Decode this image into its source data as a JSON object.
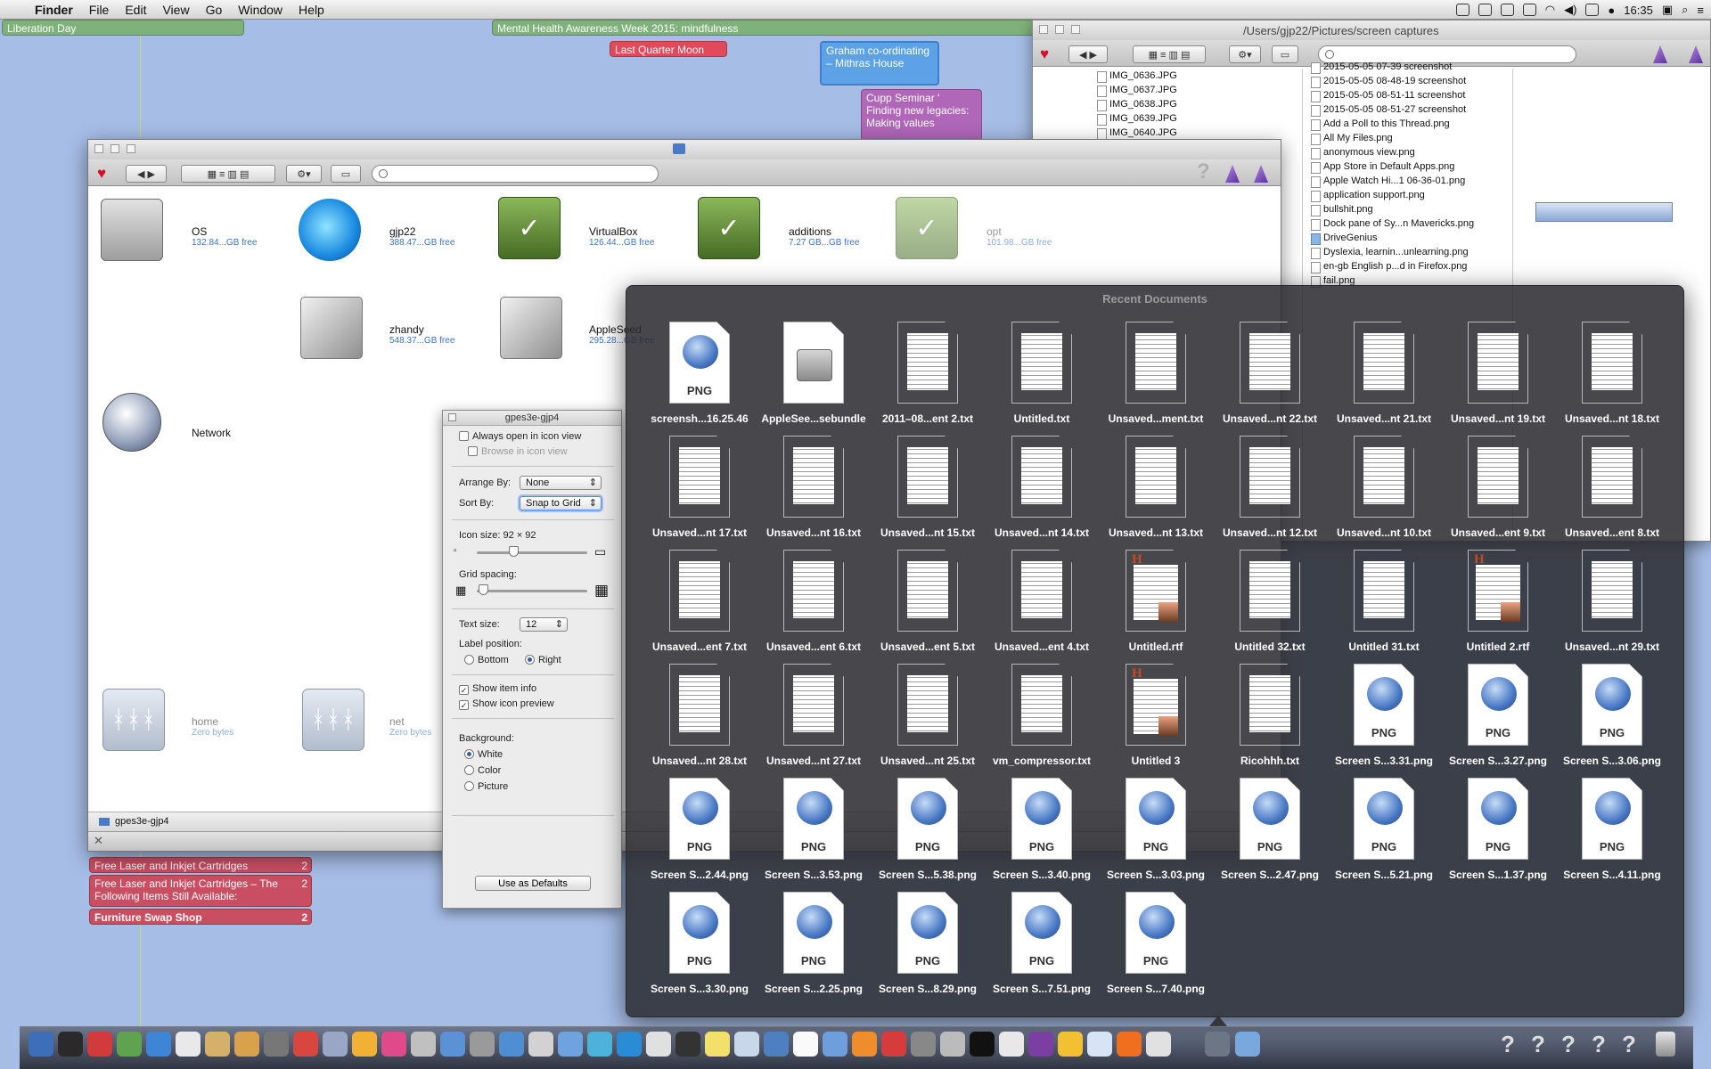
{
  "menubar": {
    "app": "Finder",
    "items": [
      "File",
      "Edit",
      "View",
      "Go",
      "Window",
      "Help"
    ],
    "clock": "16:35"
  },
  "calendar_events": {
    "liberation_day": "Liberation Day",
    "mental_health": "Mental Health Awareness Week 2015: mindfulness",
    "moon": "Last Quarter Moon",
    "graham": "Graham co-ordinating – Mithras House",
    "cupp": "Cupp Seminar ' Finding new legacies: Making values",
    "list": [
      {
        "text": "Free Laser and Inkjet Cartridges",
        "count": "2"
      },
      {
        "text": "Free Laser and Inkjet Cartridges – The Following Items Still Available:",
        "count": "2"
      },
      {
        "text": "Furniture Swap Shop",
        "count": "2"
      }
    ]
  },
  "captures_window": {
    "path": "/Users/gjp22/Pictures/screen captures",
    "col1": [
      "IMG_0636.JPG",
      "IMG_0637.JPG",
      "IMG_0638.JPG",
      "IMG_0639.JPG",
      "IMG_0640.JPG"
    ],
    "col2": [
      "2015-05-05 07-39 screenshot",
      "2015-05-05 08-48-19 screenshot",
      "2015-05-05 08-51-11 screenshot",
      "2015-05-05 08-51-27 screenshot",
      "Add a Poll to this Thread.png",
      "All My Files.png",
      "anonymous view.png",
      "App Store in Default Apps.png",
      "Apple Watch Hi...1 06-36-01.png",
      "application support.png",
      "bullshit.png",
      "Dock pane of Sy...n Mavericks.png",
      "DriveGenius",
      "Dyslexia, learnin...unlearning.png",
      "en-gb English p...d in Firefox.png",
      "fail.png"
    ]
  },
  "finder": {
    "status_title": "gpes3e-gjp4",
    "volumes": [
      {
        "name": "OS",
        "free": "132.84...GB free"
      },
      {
        "name": "gjp22",
        "free": "388.47...GB free"
      },
      {
        "name": "VirtualBox",
        "free": "126.44...GB free"
      },
      {
        "name": "additions",
        "free": "7.27 GB...GB free"
      },
      {
        "name": "opt",
        "free": "101.98...GB free"
      },
      {
        "name": "zhandy",
        "free": "548.37...GB free"
      },
      {
        "name": "AppleSeed",
        "free": "295.28...GB free"
      },
      {
        "name": "Network",
        "free": ""
      },
      {
        "name": "home",
        "free": "Zero bytes"
      },
      {
        "name": "net",
        "free": "Zero bytes"
      }
    ]
  },
  "view_options": {
    "title": "gpes3e-gjp4",
    "always_open": "Always open in icon view",
    "browse": "Browse in icon view",
    "arrange_label": "Arrange By:",
    "arrange_value": "None",
    "sort_label": "Sort By:",
    "sort_value": "Snap to Grid",
    "icon_size_label": "Icon size:",
    "icon_size_value": "92 × 92",
    "icon_size_level": 0.32,
    "grid_label": "Grid spacing:",
    "grid_level": 0.02,
    "text_size_label": "Text size:",
    "text_size_value": "12",
    "label_pos": "Label position:",
    "bottom": "Bottom",
    "right": "Right",
    "show_info": "Show item info",
    "show_preview": "Show icon preview",
    "background": "Background:",
    "white": "White",
    "color": "Color",
    "picture": "Picture",
    "defaults": "Use as Defaults"
  },
  "recent": {
    "title": "Recent Documents",
    "docs": [
      {
        "name": "screensh...16.25.46",
        "kind": "png"
      },
      {
        "name": "AppleSee...sebundle",
        "kind": "bundle"
      },
      {
        "name": "2011–08...ent 2.txt",
        "kind": "txt"
      },
      {
        "name": "Untitled.txt",
        "kind": "txt"
      },
      {
        "name": "Unsaved...ment.txt",
        "kind": "txt"
      },
      {
        "name": "Unsaved...nt 22.txt",
        "kind": "txt"
      },
      {
        "name": "Unsaved...nt 21.txt",
        "kind": "txt"
      },
      {
        "name": "Unsaved...nt 19.txt",
        "kind": "txt"
      },
      {
        "name": "Unsaved...nt 18.txt",
        "kind": "txt"
      },
      {
        "name": "Unsaved...nt 17.txt",
        "kind": "txt"
      },
      {
        "name": "Unsaved...nt 16.txt",
        "kind": "txt"
      },
      {
        "name": "Unsaved...nt 15.txt",
        "kind": "txt"
      },
      {
        "name": "Unsaved...nt 14.txt",
        "kind": "txt"
      },
      {
        "name": "Unsaved...nt 13.txt",
        "kind": "txt"
      },
      {
        "name": "Unsaved...nt 12.txt",
        "kind": "txt"
      },
      {
        "name": "Unsaved...nt 10.txt",
        "kind": "txt"
      },
      {
        "name": "Unsaved...ent 9.txt",
        "kind": "txt"
      },
      {
        "name": "Unsaved...ent 8.txt",
        "kind": "txt"
      },
      {
        "name": "Unsaved...ent 7.txt",
        "kind": "txt"
      },
      {
        "name": "Unsaved...ent 6.txt",
        "kind": "txt"
      },
      {
        "name": "Unsaved...ent 5.txt",
        "kind": "txt"
      },
      {
        "name": "Unsaved...ent 4.txt",
        "kind": "txt"
      },
      {
        "name": "Untitled.rtf",
        "kind": "rtf"
      },
      {
        "name": "Untitled 32.txt",
        "kind": "txt"
      },
      {
        "name": "Untitled 31.txt",
        "kind": "txt"
      },
      {
        "name": "Untitled 2.rtf",
        "kind": "rtf"
      },
      {
        "name": "Unsaved...nt 29.txt",
        "kind": "txt"
      },
      {
        "name": "Unsaved...nt 28.txt",
        "kind": "txt"
      },
      {
        "name": "Unsaved...nt 27.txt",
        "kind": "txt"
      },
      {
        "name": "Unsaved...nt 25.txt",
        "kind": "txt"
      },
      {
        "name": "vm_compressor.txt",
        "kind": "txt"
      },
      {
        "name": "Untitled 3",
        "kind": "rtf"
      },
      {
        "name": "Ricohhh.txt",
        "kind": "txt"
      },
      {
        "name": "Screen S...3.31.png",
        "kind": "png"
      },
      {
        "name": "Screen S...3.27.png",
        "kind": "png"
      },
      {
        "name": "Screen S...3.06.png",
        "kind": "png"
      },
      {
        "name": "Screen S...2.44.png",
        "kind": "png"
      },
      {
        "name": "Screen S...3.53.png",
        "kind": "png"
      },
      {
        "name": "Screen S...5.38.png",
        "kind": "png"
      },
      {
        "name": "Screen S...3.40.png",
        "kind": "png"
      },
      {
        "name": "Screen S...3.03.png",
        "kind": "png"
      },
      {
        "name": "Screen S...2.47.png",
        "kind": "png"
      },
      {
        "name": "Screen S...5.21.png",
        "kind": "png"
      },
      {
        "name": "Screen S...1.37.png",
        "kind": "png"
      },
      {
        "name": "Screen S...4.11.png",
        "kind": "png"
      },
      {
        "name": "Screen S...3.30.png",
        "kind": "png"
      },
      {
        "name": "Screen S...2.25.png",
        "kind": "png"
      },
      {
        "name": "Screen S...8.29.png",
        "kind": "png"
      },
      {
        "name": "Screen S...7.51.png",
        "kind": "png"
      },
      {
        "name": "Screen S...7.40.png",
        "kind": "png"
      }
    ],
    "png_label": "PNG"
  },
  "icons": {
    "heart": "heart-icon",
    "search": "search-icon",
    "gear": "gear-icon",
    "help": "question-icon"
  }
}
